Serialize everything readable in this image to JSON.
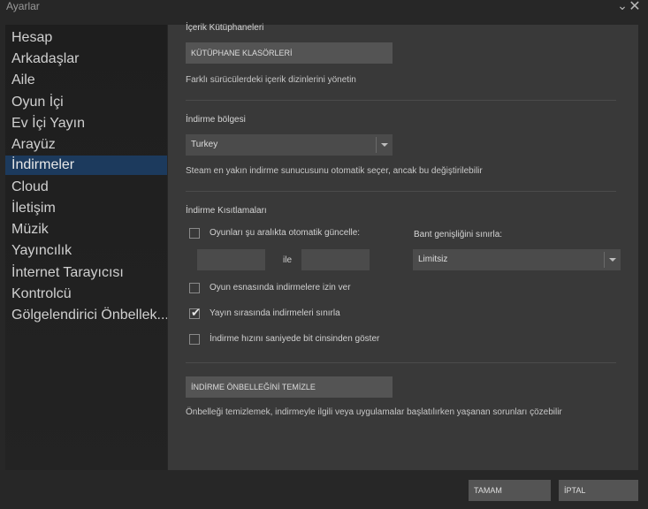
{
  "window": {
    "title": "Ayarlar",
    "minimize_label": "⌄",
    "close_label": "✕"
  },
  "sidebar": {
    "items": [
      {
        "label": "Hesap"
      },
      {
        "label": "Arkadaşlar"
      },
      {
        "label": "Aile"
      },
      {
        "label": "Oyun İçi"
      },
      {
        "label": "Ev İçi Yayın"
      },
      {
        "label": "Arayüz"
      },
      {
        "label": "İndirmeler",
        "active": true
      },
      {
        "label": "Cloud"
      },
      {
        "label": "İletişim"
      },
      {
        "label": "Müzik"
      },
      {
        "label": "Yayıncılık"
      },
      {
        "label": "İnternet Tarayıcısı"
      },
      {
        "label": "Kontrolcü"
      },
      {
        "label": "Gölgelendirici Önbellek..."
      }
    ]
  },
  "library": {
    "heading": "İçerik Kütüphaneleri",
    "button": "KÜTÜPHANE KLASÖRLERİ",
    "description": "Farklı sürücülerdeki içerik dizinlerini yönetin"
  },
  "region": {
    "heading": "İndirme bölgesi",
    "selected": "Turkey",
    "description": "Steam en yakın indirme sunucusunu otomatik seçer, ancak bu değiştirilebilir"
  },
  "restrictions": {
    "heading": "İndirme Kısıtlamaları",
    "auto_update_label": "Oyunları şu aralıkta otomatik güncelle:",
    "auto_update_checked": false,
    "range_from": "",
    "range_to": "",
    "range_separator": "ile",
    "bandwidth_label": "Bant genişliğini sınırla:",
    "bandwidth_selected": "Limitsiz",
    "options": [
      {
        "label": "Oyun esnasında indirmelere izin ver",
        "checked": false
      },
      {
        "label": "Yayın sırasında indirmeleri sınırla",
        "checked": true
      },
      {
        "label": "İndirme hızını saniyede bit cinsinden göster",
        "checked": false
      }
    ]
  },
  "cache": {
    "button": "İNDİRME ÖNBELLEĞİNİ TEMİZLE",
    "description": "Önbelleği temizlemek, indirmeyle ilgili veya uygulamalar başlatılırken yaşanan sorunları çözebilir"
  },
  "footer": {
    "ok": "TAMAM",
    "cancel": "İPTAL"
  },
  "colors": {
    "window_bg": "#272727",
    "panel_bg": "#393939",
    "sidebar_bg": "#1e1e1e",
    "active_item": "#1c3a5d",
    "button_bg": "#545454"
  }
}
